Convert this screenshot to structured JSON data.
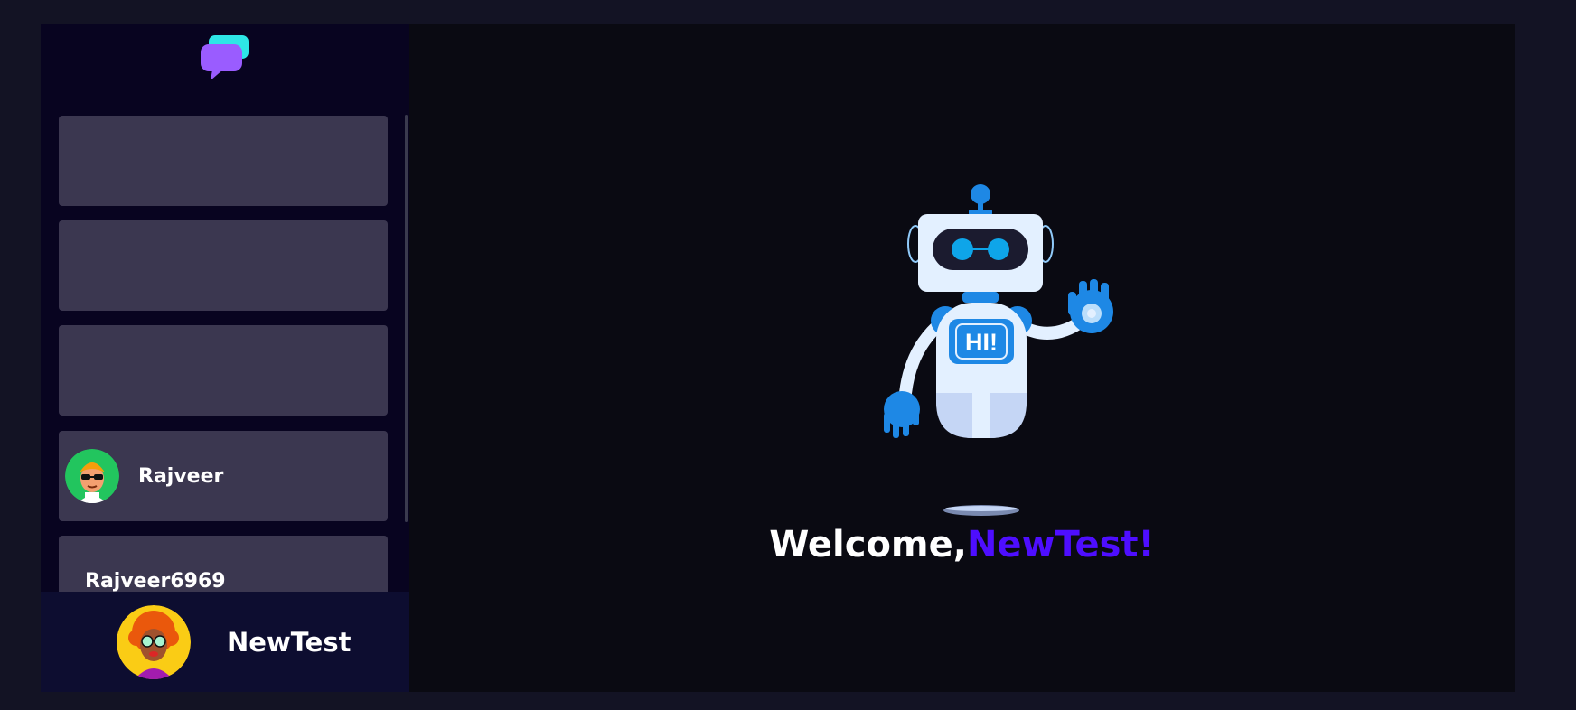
{
  "sidebar": {
    "contacts": [
      {
        "name": ""
      },
      {
        "name": ""
      },
      {
        "name": ""
      },
      {
        "name": "Rajveer",
        "avatar_icon": "boy-sunglasses-avatar-icon"
      },
      {
        "name": "Rajveer6969"
      }
    ]
  },
  "current_user": {
    "name": "NewTest",
    "avatar_icon": "curly-hair-glasses-avatar-icon"
  },
  "welcome": {
    "prefix": "Welcome,",
    "username": "NewTest!"
  },
  "colors": {
    "accent": "#4e0eff",
    "background": "#131324",
    "sidebar": "#080420",
    "contact_card": "#3b3750",
    "current_user_bar": "#0d0d30",
    "main": "#0a0a12"
  }
}
